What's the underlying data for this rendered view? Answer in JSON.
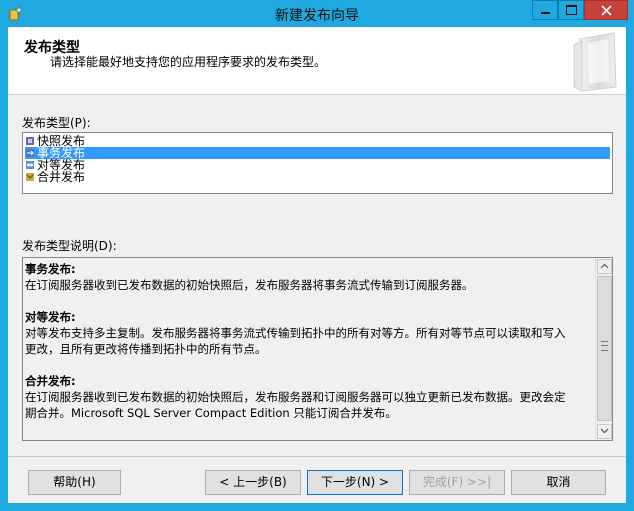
{
  "window": {
    "title": "新建发布向导",
    "controls": {
      "minimize": "▬",
      "maximize": "□",
      "close": "✕"
    }
  },
  "header": {
    "title": "发布类型",
    "description": "请选择能最好地支持您的应用程序要求的发布类型。"
  },
  "publication_type": {
    "label": "发布类型(P):",
    "items": [
      {
        "label": "快照发布",
        "icon": "snapshot-publication-icon",
        "selected": false
      },
      {
        "label": "事务发布",
        "icon": "transactional-publication-icon",
        "selected": true
      },
      {
        "label": "对等发布",
        "icon": "peer-to-peer-publication-icon",
        "selected": false
      },
      {
        "label": "合并发布",
        "icon": "merge-publication-icon",
        "selected": false
      }
    ]
  },
  "description": {
    "label": "发布类型说明(D):",
    "sections": [
      {
        "heading": "事务发布:",
        "lines": [
          "在订阅服务器收到已发布数据的初始快照后，发布服务器将事务流式传输到订阅服务器。"
        ]
      },
      {
        "heading": "对等发布:",
        "lines": [
          "对等发布支持多主复制。发布服务器将事务流式传输到拓扑中的所有对等方。所有对等节点可以读取和写入",
          "更改，且所有更改将传播到拓扑中的所有节点。"
        ]
      },
      {
        "heading": "合并发布:",
        "lines": [
          "在订阅服务器收到已发布数据的初始快照后，发布服务器和订阅服务器可以独立更新已发布数据。更改会定",
          "期合并。Microsoft SQL Server Compact Edition 只能订阅合并发布。"
        ]
      }
    ]
  },
  "buttons": {
    "help": "帮助(H)",
    "back": "< 上一步(B)",
    "next": "下一步(N) >",
    "finish": "完成(F) >>|",
    "cancel": "取消"
  },
  "colors": {
    "titlebar": "#1fa9e0",
    "close_button": "#c7413b",
    "selection": "#3399ff"
  }
}
